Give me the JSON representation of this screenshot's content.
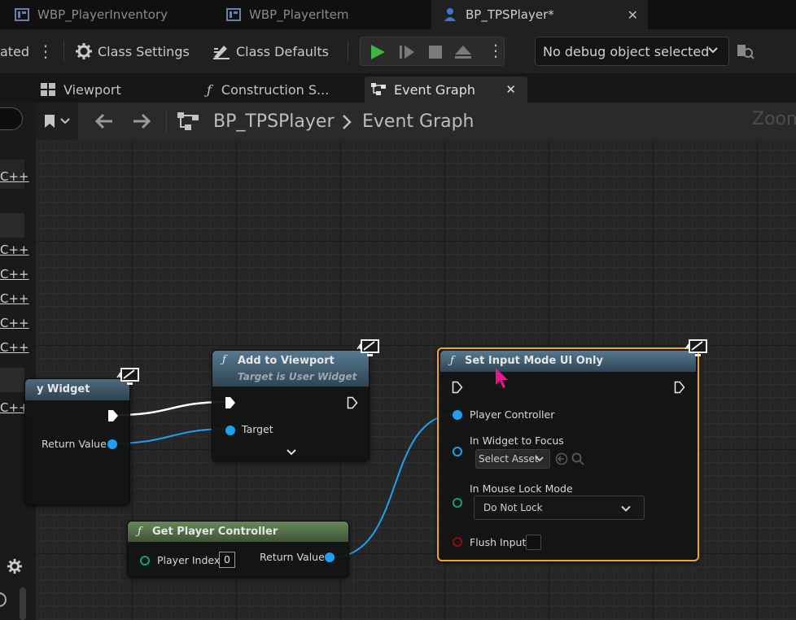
{
  "document_tabs": [
    {
      "label": "WBP_PlayerInventory",
      "active": false
    },
    {
      "label": "WBP_PlayerItem",
      "active": false
    },
    {
      "label": "BP_TPSPlayer*",
      "active": true
    }
  ],
  "toolbar": {
    "compile_status_fragment": "ated",
    "class_settings": "Class Settings",
    "class_defaults": "Class Defaults",
    "debug_object": "No debug object selected"
  },
  "sub_tabs": [
    {
      "label": "Viewport",
      "active": false
    },
    {
      "label": "Construction S...",
      "active": false
    },
    {
      "label": "Event Graph",
      "active": true
    }
  ],
  "left_panel": {
    "cpp_labels": [
      "C++",
      "C++",
      "C++",
      "C++",
      "C++",
      "C++",
      "C++"
    ]
  },
  "breadcrumb": {
    "blueprint": "BP_TPSPlayer",
    "graph": "Event Graph",
    "zoom_fragment": "Zoom"
  },
  "nodes": {
    "create_widget": {
      "title_fragment": "y Widget",
      "return_value": "Return Value"
    },
    "add_to_viewport": {
      "title": "Add to Viewport",
      "subtitle": "Target is User Widget",
      "target": "Target"
    },
    "get_player_controller": {
      "title": "Get Player Controller",
      "player_index_label": "Player Index",
      "player_index_value": "0",
      "return_value": "Return Value"
    },
    "set_input_mode": {
      "title": "Set Input Mode UI Only",
      "player_controller": "Player Controller",
      "widget_to_focus": "In Widget to Focus",
      "select_asset": "Select Asset",
      "mouse_lock_mode": "In Mouse Lock Mode",
      "mouse_lock_value": "Do Not Lock",
      "flush_input": "Flush Input",
      "flush_input_checked": false
    }
  },
  "colors": {
    "function_header": "#3c5a6e",
    "pure_header": "#5c7a52",
    "object_pin": "#1ea1f2",
    "struct_pin": "#1a9e6a",
    "bool_pin": "#8c0f0f",
    "selection": "#f3a51f",
    "cursor": "#e5178c"
  }
}
